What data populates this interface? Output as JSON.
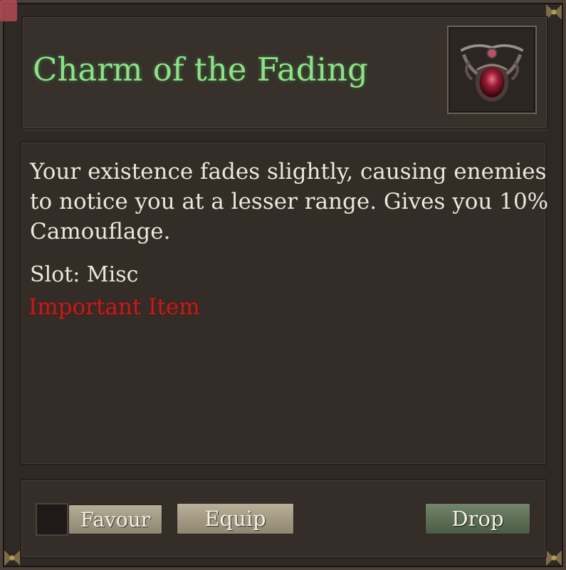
{
  "item": {
    "name": "Charm of the Fading",
    "icon": "red-gem-charm-icon",
    "description": "Your existence fades slightly, causing enemies to notice you at a lesser range. Gives you 10% Camouflage.",
    "slot": "Slot: Misc",
    "tag": "Important Item"
  },
  "actions": {
    "favour_label": "Favour",
    "equip_label": "Equip",
    "drop_label": "Drop"
  },
  "colors": {
    "title": "#8fe08a",
    "important": "#c21b1b",
    "panel": "#332c27"
  }
}
